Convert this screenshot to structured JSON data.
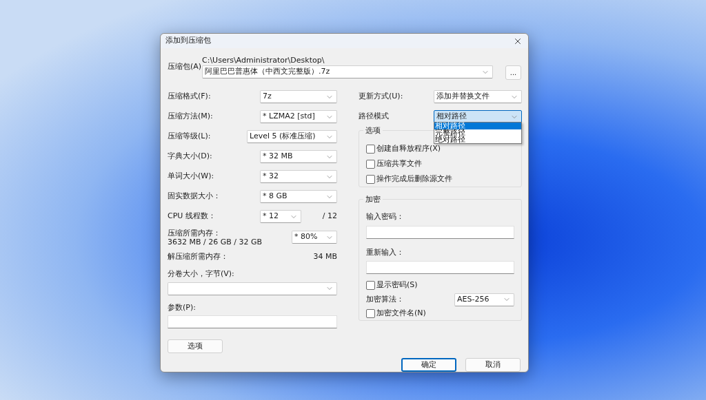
{
  "window": {
    "title": "添加到压缩包"
  },
  "archive": {
    "label": "压缩包(A)",
    "path": "C:\\Users\\Administrator\\Desktop\\",
    "value": "阿里巴巴普惠体（中西文完整版）.7z",
    "browse": "..."
  },
  "left_fields": [
    {
      "kind": "combo",
      "label": "压缩格式(F):",
      "value": "7z"
    },
    {
      "kind": "combo",
      "label": "压缩方法(M):",
      "value": "*  LZMA2 [std]"
    },
    {
      "kind": "combo-wide",
      "label": "压缩等级(L):",
      "value": "Level 5 (标准压缩)"
    },
    {
      "kind": "combo",
      "label": "字典大小(D):",
      "value": "*  32 MB"
    },
    {
      "kind": "combo",
      "label": "单词大小(W):",
      "value": "*  32"
    },
    {
      "kind": "combo",
      "label": "固实数据大小：",
      "value": "*  8 GB"
    },
    {
      "kind": "combo-short",
      "label": "CPU 线程数：",
      "value": "*  12",
      "suffix": "/ 12"
    },
    {
      "kind": "memory",
      "label": "压缩所需内存：",
      "detail": "3632 MB / 26 GB / 32 GB",
      "value": "*  80%"
    },
    {
      "kind": "reading",
      "label": "解压缩所需内存：",
      "value": "34 MB"
    }
  ],
  "volume": {
    "label": "分卷大小，字节(V):"
  },
  "parameters": {
    "label": "参数(P):"
  },
  "options_button": "选项",
  "update_mode": {
    "label": "更新方式(U):",
    "value": "添加并替换文件"
  },
  "path_mode": {
    "label": "路径模式",
    "value": "相对路径",
    "expanded": true,
    "options": [
      {
        "label": "相对路径",
        "selected": true
      },
      {
        "label": "完整路径",
        "selected": false
      },
      {
        "label": "绝对路径",
        "selected": false
      }
    ]
  },
  "options_group": {
    "title": "选项",
    "checkboxes": [
      {
        "label": "创建自释放程序(X)",
        "checked": false
      },
      {
        "label": "压缩共享文件",
        "checked": false
      },
      {
        "label": "操作完成后删除源文件",
        "checked": false
      }
    ]
  },
  "encryption": {
    "title": "加密",
    "password_label": "输入密码：",
    "reenter_label": "重新输入：",
    "show_password": {
      "label": "显示密码(S)",
      "checked": false
    },
    "method_label": "加密算法：",
    "method": "AES-256",
    "encrypt_names": {
      "label": "加密文件名(N)",
      "checked": false
    }
  },
  "buttons": [
    {
      "label": "确定",
      "default": true
    },
    {
      "label": "取消",
      "default": false
    }
  ]
}
